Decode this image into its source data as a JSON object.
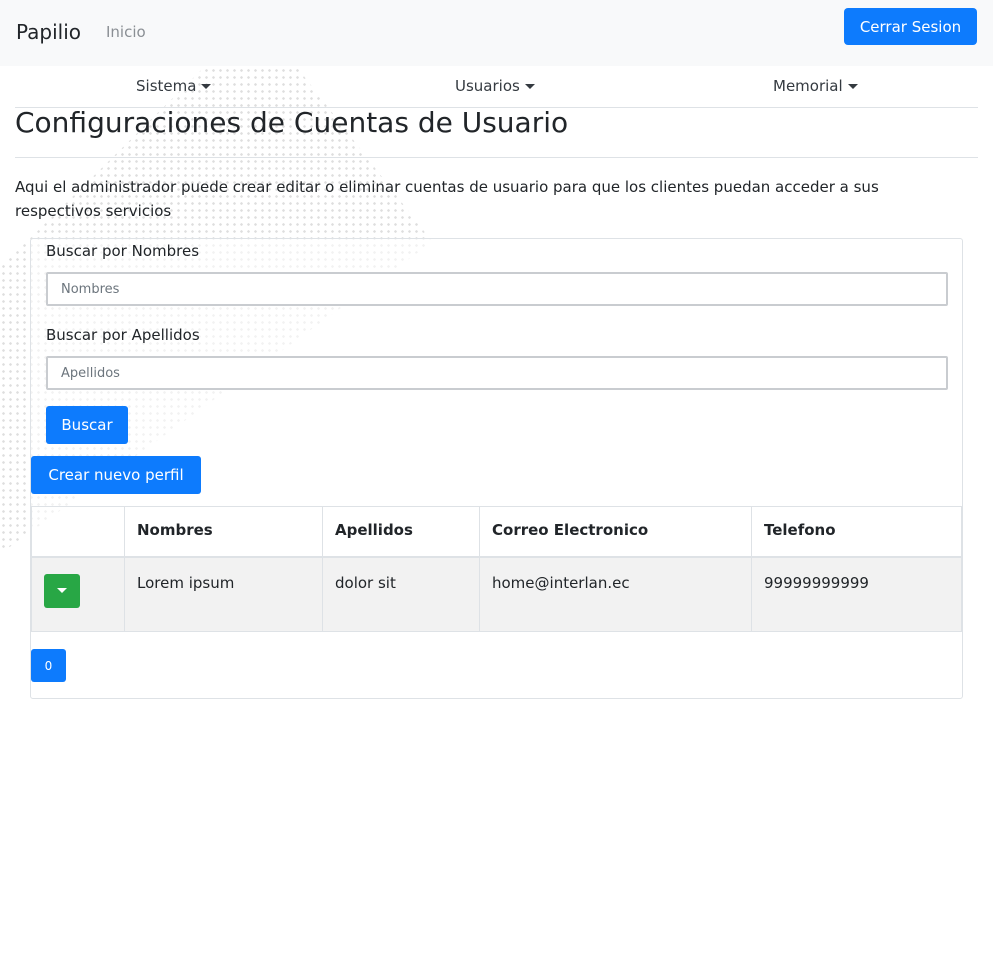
{
  "navbar": {
    "brand": "Papilio",
    "home_link": "Inicio",
    "logout_label": "Cerrar Sesion"
  },
  "subnav": {
    "items": [
      {
        "label": "Sistema"
      },
      {
        "label": "Usuarios"
      },
      {
        "label": "Memorial"
      }
    ]
  },
  "page": {
    "title": "Configuraciones de Cuentas de Usuario",
    "description": "Aqui el administrador puede crear editar o eliminar cuentas de usuario para que los clientes puedan acceder a sus respectivos servicios"
  },
  "search": {
    "names_label": "Buscar por Nombres",
    "names_placeholder": "Nombres",
    "surnames_label": "Buscar por Apellidos",
    "surnames_placeholder": "Apellidos",
    "search_button": "Buscar",
    "create_button": "Crear nuevo perfil"
  },
  "table": {
    "headers": [
      "",
      "Nombres",
      "Apellidos",
      "Correo Electronico",
      "Telefono"
    ],
    "rows": [
      {
        "nombres": "Lorem ipsum",
        "apellidos": "dolor sit",
        "correo": "home@interlan.ec",
        "telefono": "99999999999"
      }
    ]
  },
  "pagination": {
    "current": "0"
  },
  "colors": {
    "primary": "#0d7bfd",
    "success": "#28a745",
    "navbar_bg": "#f8f9fa"
  }
}
